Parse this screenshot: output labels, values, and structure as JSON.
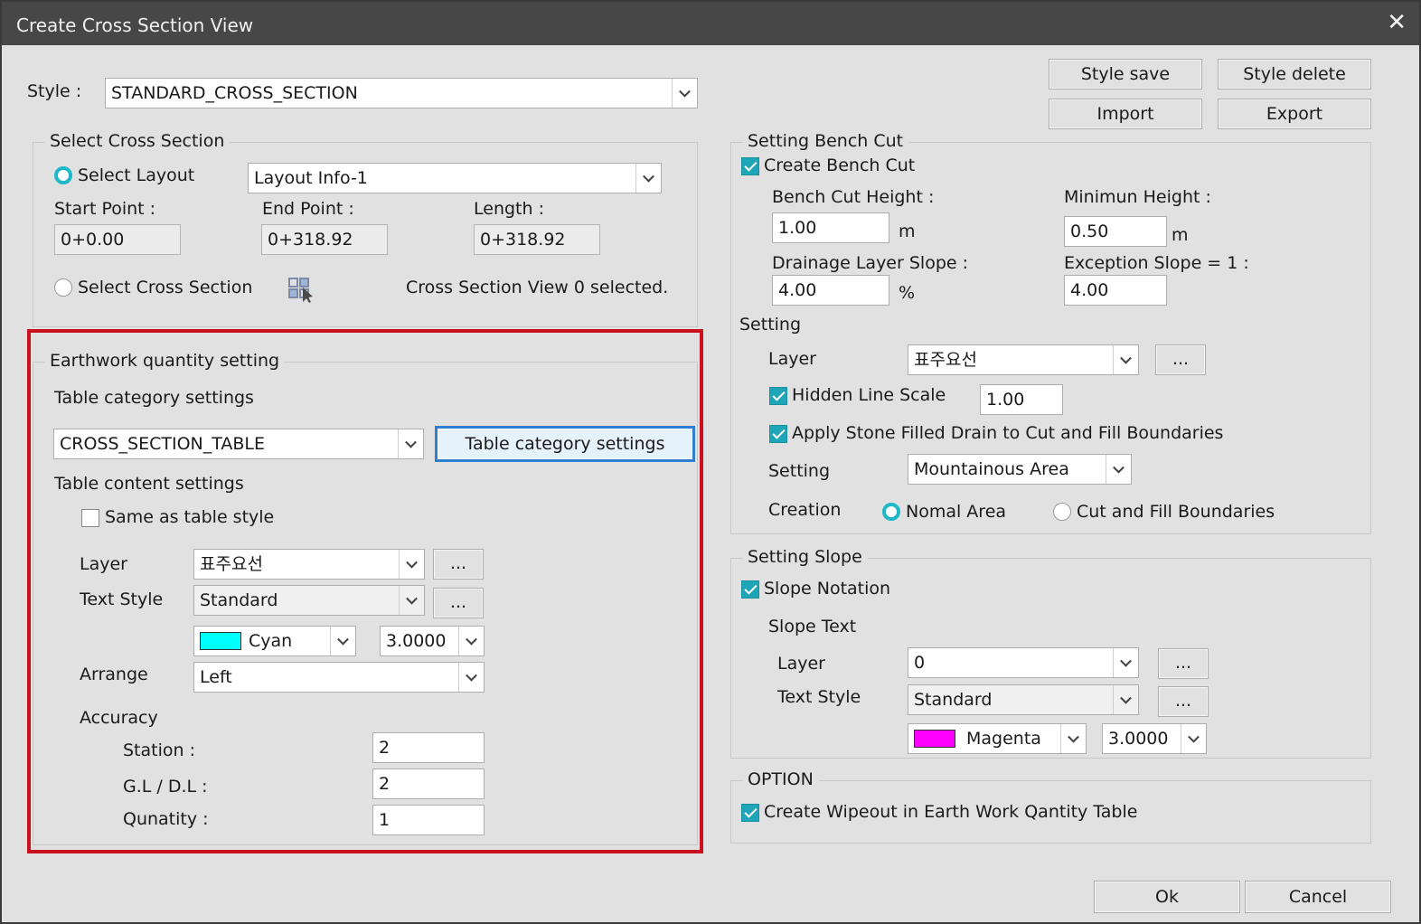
{
  "window": {
    "title": "Create Cross Section View",
    "close_icon": "close-icon"
  },
  "style": {
    "label": "Style :",
    "value": "STANDARD_CROSS_SECTION"
  },
  "buttons": {
    "style_save": "Style save",
    "style_delete": "Style delete",
    "import": "Import",
    "export": "Export",
    "ok": "Ok",
    "cancel": "Cancel"
  },
  "select_cross_section": {
    "title": "Select Cross Section",
    "select_layout_label": "Select Layout",
    "layout_value": "Layout Info-1",
    "start_label": "Start Point :",
    "start_value": "0+0.00",
    "end_label": "End Point :",
    "end_value": "0+318.92",
    "length_label": "Length :",
    "length_value": "0+318.92",
    "select_cs_label": "Select Cross Section",
    "status": "Cross Section View 0 selected."
  },
  "earthwork": {
    "title": "Earthwork quantity setting",
    "table_category_label": "Table category settings",
    "table_value": "CROSS_SECTION_TABLE",
    "table_category_button": "Table category settings",
    "table_content_label": "Table content settings",
    "same_as_label": "Same as table style",
    "layer_label": "Layer",
    "layer_value": "표주요선",
    "text_style_label": "Text Style",
    "text_style_value": "Standard",
    "color_name": "Cyan",
    "color_hex": "#00ffff",
    "height_value": "3.0000",
    "arrange_label": "Arrange",
    "arrange_value": "Left",
    "accuracy_label": "Accuracy",
    "station_label": "Station :",
    "station_value": "2",
    "gl_label": "G.L / D.L :",
    "gl_value": "2",
    "quantity_label": "Qunatity :",
    "quantity_value": "1",
    "ellipsis": "..."
  },
  "bench_cut": {
    "title": "Setting Bench Cut",
    "create_label": "Create Bench Cut",
    "height_label": "Bench Cut Height :",
    "height_value": "1.00",
    "height_unit": "m",
    "min_label": "Minimun Height :",
    "min_value": "0.50",
    "min_unit": "m",
    "drain_label": "Drainage Layer Slope :",
    "drain_value": "4.00",
    "drain_unit": "%",
    "exception_label": "Exception Slope = 1 :",
    "exception_value": "4.00",
    "setting_label": "Setting",
    "layer_label": "Layer",
    "layer_value": "표주요선",
    "hidden_label": "Hidden Line Scale",
    "hidden_value": "1.00",
    "apply_label": "Apply Stone Filled Drain to Cut and Fill Boundaries",
    "setting2_label": "Setting",
    "setting2_value": "Mountainous Area",
    "creation_label": "Creation",
    "normal_label": "Nomal Area",
    "cutfill_label": "Cut and Fill Boundaries",
    "ellipsis": "..."
  },
  "slope": {
    "title": "Setting Slope",
    "notation_label": "Slope Notation",
    "text_label": "Slope Text",
    "layer_label": "Layer",
    "layer_value": "0",
    "text_style_label": "Text Style",
    "text_style_value": "Standard",
    "color_name": "Magenta",
    "color_hex": "#ff00ff",
    "height_value": "3.0000",
    "ellipsis": "..."
  },
  "option": {
    "title": "OPTION",
    "wipeout_label": "Create Wipeout in Earth Work Qantity Table"
  },
  "colors": {
    "highlight_red": "#c8101e",
    "highlight_blue": "#2f7fd1",
    "check_accent": "#1fa5b8"
  }
}
